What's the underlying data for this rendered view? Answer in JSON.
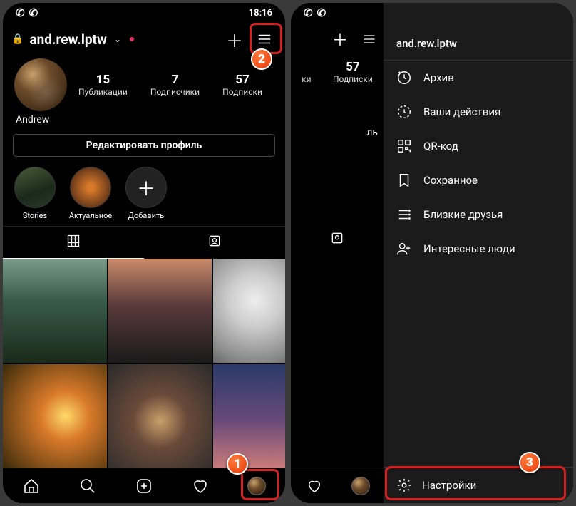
{
  "status": {
    "time": "18:16"
  },
  "profile": {
    "username": "and.rew.lptw",
    "display_name": "Andrew",
    "posts_count": "15",
    "posts_label": "Публикации",
    "followers_count": "7",
    "followers_label": "Подписчики",
    "following_count": "57",
    "following_label": "Подписки",
    "edit_button": "Редактировать профиль",
    "highlights": [
      {
        "label": "Stories"
      },
      {
        "label": "Актуальное"
      },
      {
        "label": "Добавить"
      }
    ]
  },
  "side_menu": {
    "title": "and.rew.lptw",
    "items": [
      {
        "label": "Архив"
      },
      {
        "label": "Ваши действия"
      },
      {
        "label": "QR-код"
      },
      {
        "label": "Сохранное"
      },
      {
        "label": "Близкие друзья"
      },
      {
        "label": "Интересные люди"
      }
    ],
    "settings_label": "Настройки"
  },
  "phone2_stats": {
    "col1_top": "ки",
    "col1_label1": "",
    "following_count": "57",
    "following_label": "Подписки",
    "tail": "ль"
  },
  "annotations": {
    "n1": "1",
    "n2": "2",
    "n3": "3"
  }
}
